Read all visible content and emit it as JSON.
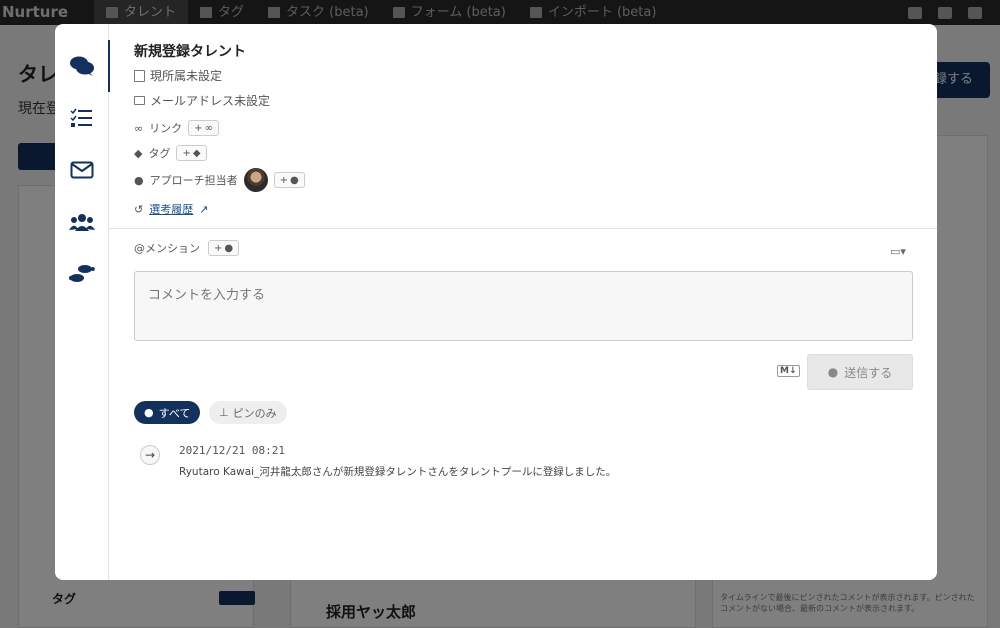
{
  "app": {
    "brand": "Nurture",
    "nav": [
      {
        "label": "タレント"
      },
      {
        "label": "タグ"
      },
      {
        "label": "タスク (beta)"
      },
      {
        "label": "フォーム (beta)"
      },
      {
        "label": "インポート (beta)"
      }
    ],
    "background": {
      "page_title": "タレ",
      "subtitle": "現在登",
      "right_button": "録する",
      "tag_label": "タグ",
      "card_title": "採用ヤッ太郎",
      "side_note": "タイムラインで最後にピンされたコメントが表示されます。ピンされたコメントがない場合、最新のコメントが表示されます。"
    }
  },
  "modal": {
    "talent_name": "新規登録タレント",
    "affiliation": "現所属未設定",
    "email": "メールアドレス未設定",
    "link_label": "リンク",
    "tag_label": "タグ",
    "approach_label": "アプローチ担当者",
    "history_link": "選考履歴",
    "mention_label": "@メンション",
    "comment_placeholder": "コメントを入力する",
    "markdown_badge": "M↓",
    "send_button": "送信する",
    "filter_all": "すべて",
    "filter_pin": "ピンのみ",
    "timeline": [
      {
        "date": "2021/12/21 08:21",
        "text": "Ryutaro Kawai_河井龍太郎さんが新規登録タレントさんをタレントプールに登録しました。"
      }
    ]
  }
}
